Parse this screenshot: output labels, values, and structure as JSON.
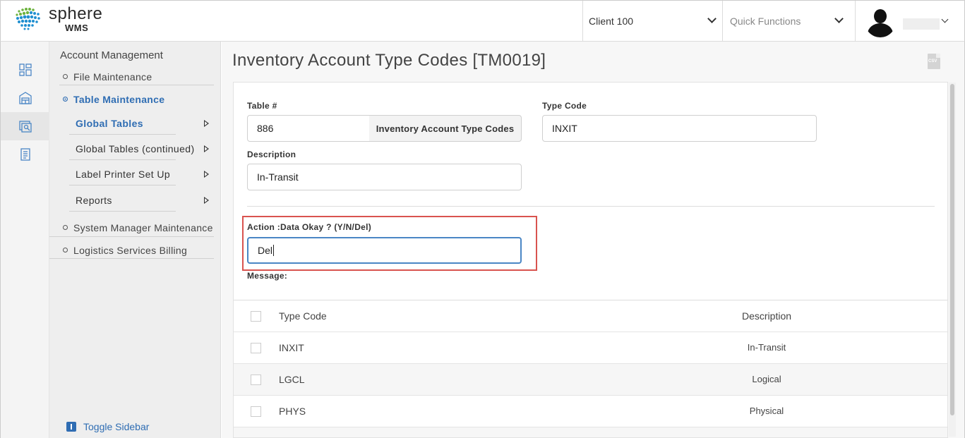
{
  "header": {
    "logo_text": "sphere",
    "logo_sub": "WMS",
    "client_select": "Client 100",
    "quick_functions_placeholder": "Quick Functions"
  },
  "sidebar": {
    "heading": "Account Management",
    "items": [
      {
        "label": "File Maintenance"
      },
      {
        "label": "Table Maintenance",
        "active": true
      },
      {
        "label": "System Manager Maintenance"
      },
      {
        "label": "Logistics Services Billing"
      }
    ],
    "subitems": [
      {
        "label": "Global Tables",
        "active": true
      },
      {
        "label": "Global Tables (continued)"
      },
      {
        "label": "Label Printer Set Up"
      },
      {
        "label": "Reports"
      }
    ],
    "toggle_label": "Toggle Sidebar"
  },
  "page": {
    "title": "Inventory Account Type Codes [TM0019]",
    "csv_label": "CSV"
  },
  "form": {
    "table_label": "Table #",
    "table_value": "886",
    "table_addon": "Inventory Account Type Codes",
    "type_code_label": "Type Code",
    "type_code_value": "INXIT",
    "description_label": "Description",
    "description_value": "In-Transit",
    "action_label": "Action :Data Okay ? (Y/N/Del)",
    "action_value": "Del",
    "message_label": "Message:"
  },
  "table": {
    "headers": {
      "type_code": "Type Code",
      "description": "Description"
    },
    "rows": [
      {
        "type_code": "INXIT",
        "description": "In-Transit"
      },
      {
        "type_code": "LGCL",
        "description": "Logical"
      },
      {
        "type_code": "PHYS",
        "description": "Physical"
      }
    ]
  }
}
